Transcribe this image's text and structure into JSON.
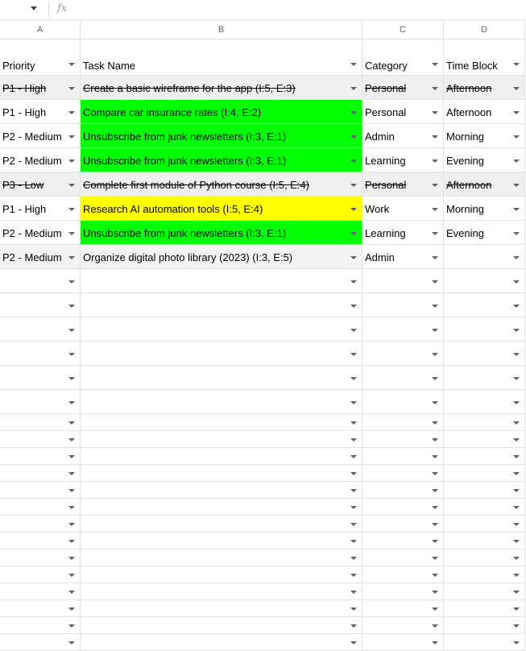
{
  "formula_bar": {
    "fx_label": "fx"
  },
  "columns": [
    "A",
    "B",
    "C",
    "D"
  ],
  "headers": [
    "Priority",
    "Task Name",
    "Category",
    "Time Block"
  ],
  "rows": [
    {
      "priority": "P1 - High",
      "task": "Create a basic wireframe for the app (I:5, E:3)",
      "category": "Personal",
      "time_block": "Afternoon",
      "done": true,
      "task_fill": ""
    },
    {
      "priority": "P1 - High",
      "task": "Compare car insurance rates (I:4, E:2)",
      "category": "Personal",
      "time_block": "Afternoon",
      "done": false,
      "task_fill": "#00ff00"
    },
    {
      "priority": "P2 - Medium",
      "task": "Unsubscribe from junk newsletters (I:3, E:1)",
      "category": "Admin",
      "time_block": "Morning",
      "done": false,
      "task_fill": "#00ff00"
    },
    {
      "priority": "P2 - Medium",
      "task": "Unsubscribe from junk newsletters (I:3, E:1)",
      "category": "Learning",
      "time_block": "Evening",
      "done": false,
      "task_fill": "#00ff00"
    },
    {
      "priority": "P3 - Low",
      "task": "Complete first module of Python course (I:5, E:4)",
      "category": "Personal",
      "time_block": "Afternoon",
      "done": true,
      "task_fill": ""
    },
    {
      "priority": "P1 - High",
      "task": "Research AI automation tools (I:5, E:4)",
      "category": "Work",
      "time_block": "Morning",
      "done": false,
      "task_fill": "#ffff00"
    },
    {
      "priority": "P2 - Medium",
      "task": "Unsubscribe from junk newsletters (I:3, E:1)",
      "category": "Learning",
      "time_block": "Evening",
      "done": false,
      "task_fill": "#00ff00"
    },
    {
      "priority": "P2 - Medium",
      "task": "Organize digital photo library (2023) (I:3, E:5)",
      "category": "Admin",
      "time_block": "",
      "done": false,
      "task_fill": "#f3f3f3"
    }
  ],
  "empty_row_count": 21,
  "colors": {
    "done_fill": "#efefef",
    "green_fill": "#00ff00",
    "yellow_fill": "#ffff00",
    "gridline": "#e2e2e2"
  }
}
